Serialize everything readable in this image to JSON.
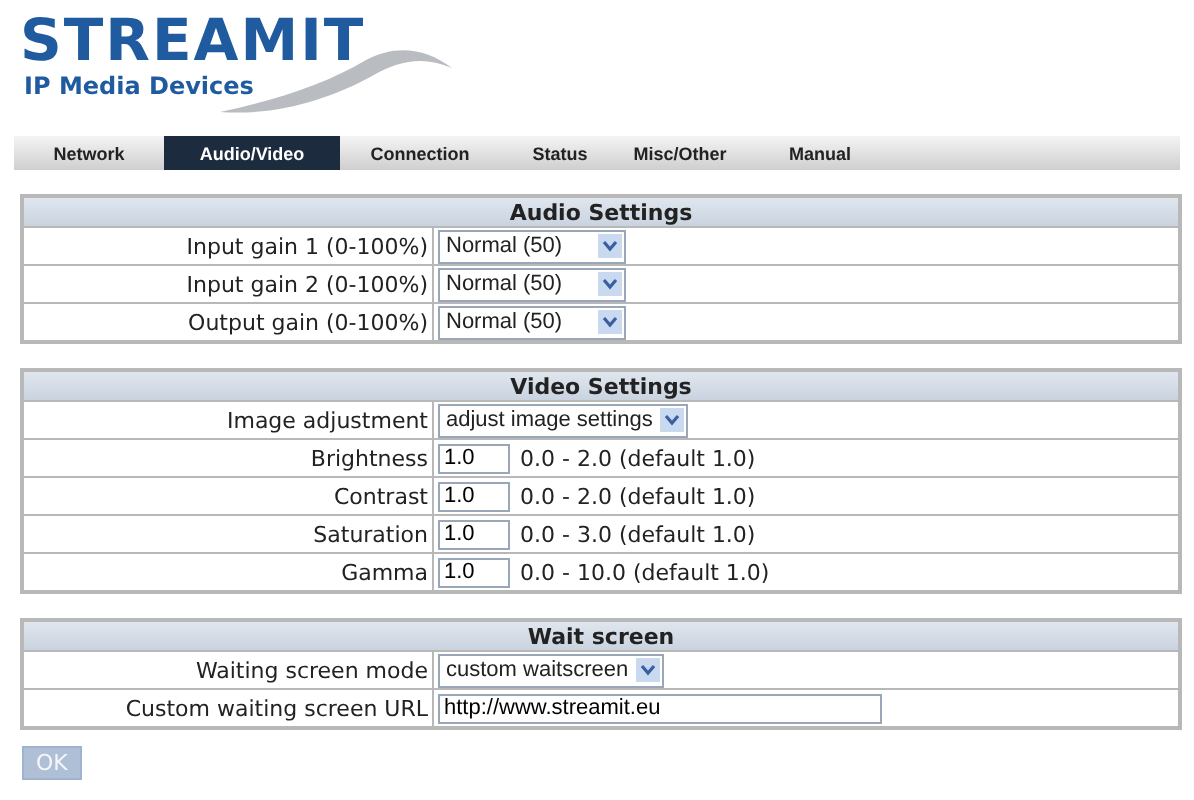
{
  "logo": {
    "brand": "STREAMIT",
    "tagline": "IP Media Devices"
  },
  "tabs": [
    {
      "label": "Network",
      "selected": false
    },
    {
      "label": "Audio/Video",
      "selected": true
    },
    {
      "label": "Connection",
      "selected": false
    },
    {
      "label": "Status",
      "selected": false
    },
    {
      "label": "Misc/Other",
      "selected": false
    },
    {
      "label": "Manual",
      "selected": false
    }
  ],
  "sections": [
    {
      "title": "Audio Settings",
      "rows": [
        {
          "kind": "select",
          "label": "Input gain 1 (0-100%)",
          "value": "Normal (50)"
        },
        {
          "kind": "select",
          "label": "Input gain 2 (0-100%)",
          "value": "Normal (50)"
        },
        {
          "kind": "select",
          "label": "Output gain (0-100%)",
          "value": "Normal (50)"
        }
      ]
    },
    {
      "title": "Video Settings",
      "rows": [
        {
          "kind": "select",
          "label": "Image adjustment",
          "value": "adjust image settings"
        },
        {
          "kind": "number",
          "label": "Brightness",
          "value": "1.0",
          "hint": "0.0 - 2.0 (default 1.0)"
        },
        {
          "kind": "number",
          "label": "Contrast",
          "value": "1.0",
          "hint": "0.0 - 2.0 (default 1.0)"
        },
        {
          "kind": "number",
          "label": "Saturation",
          "value": "1.0",
          "hint": "0.0 - 3.0 (default 1.0)"
        },
        {
          "kind": "number",
          "label": "Gamma",
          "value": "1.0",
          "hint": "0.0 - 10.0 (default 1.0)"
        }
      ]
    },
    {
      "title": "Wait screen",
      "rows": [
        {
          "kind": "select",
          "label": "Waiting screen mode",
          "value": "custom waitscreen"
        },
        {
          "kind": "url",
          "label": "Custom waiting screen URL",
          "value": "http://www.streamit.eu"
        }
      ]
    }
  ],
  "submit": {
    "label": "OK",
    "disabled": true
  }
}
